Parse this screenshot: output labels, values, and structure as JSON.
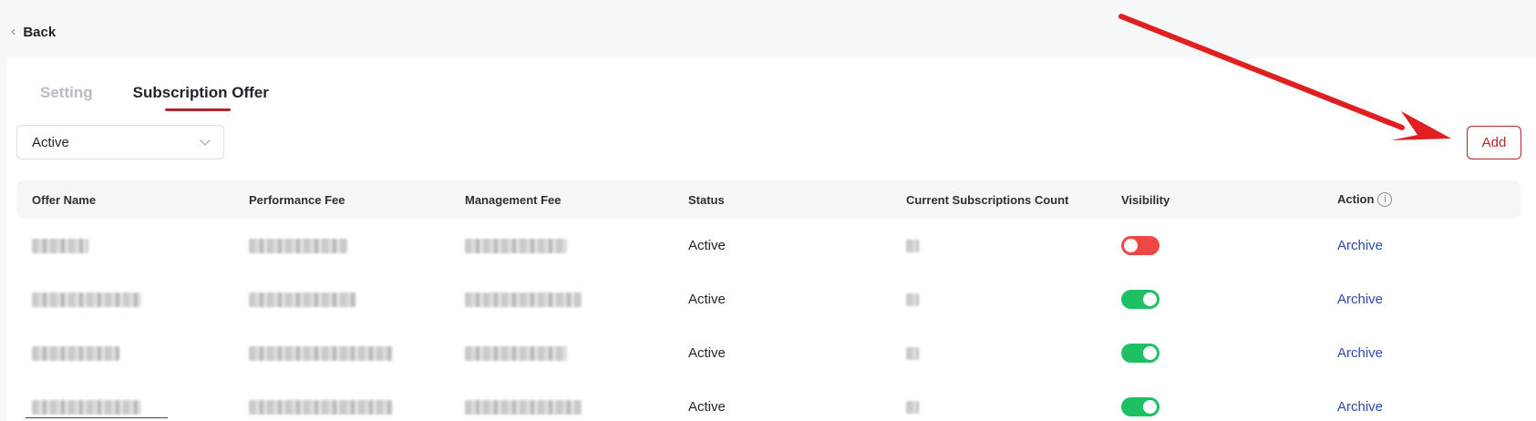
{
  "nav": {
    "back_label": "Back"
  },
  "tabs": [
    {
      "label": "Setting",
      "active": false
    },
    {
      "label": "Subscription Offer",
      "active": true
    }
  ],
  "filter": {
    "selected": "Active"
  },
  "toolbar": {
    "add_label": "Add"
  },
  "table": {
    "headers": [
      "Offer Name",
      "Performance Fee",
      "Management Fee",
      "Status",
      "Current Subscriptions Count",
      "Visibility",
      "Action"
    ],
    "rows": [
      {
        "status": "Active",
        "visibility": "off",
        "action": "Archive"
      },
      {
        "status": "Active",
        "visibility": "on",
        "action": "Archive"
      },
      {
        "status": "Active",
        "visibility": "on",
        "action": "Archive"
      },
      {
        "status": "Active",
        "visibility": "on",
        "action": "Archive"
      }
    ]
  },
  "colors": {
    "accent": "#b3262c",
    "toggle_on": "#1fbf63",
    "toggle_off": "#f04646",
    "link": "#2e4aa8",
    "annotation_arrow": "#e02020"
  },
  "icons": {
    "back": "chevron-left-icon",
    "dropdown": "chevron-down-icon",
    "info": "info-circle-icon"
  }
}
